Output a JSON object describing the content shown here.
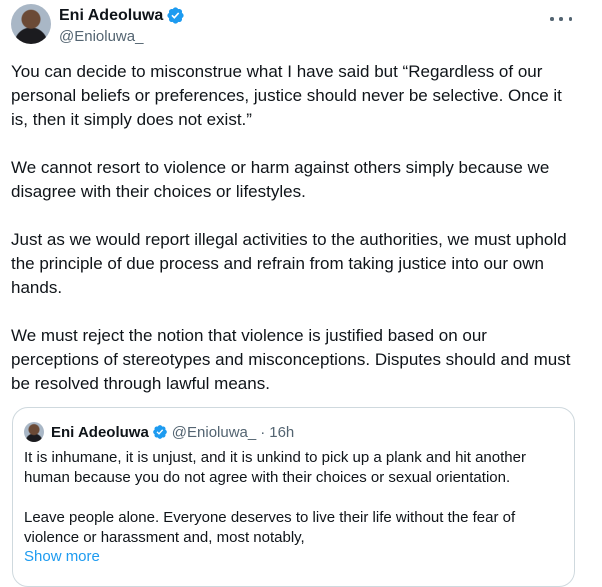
{
  "tweet": {
    "author": {
      "name": "Eni Adeoluwa",
      "handle": "@Enioluwa_"
    },
    "paragraphs": [
      "You can decide to misconstrue what I have said but “Regardless of our personal beliefs or preferences, justice should never be selective. Once it is, then it simply does not exist.”",
      "We cannot resort to violence or harm against others simply because we disagree with their choices or lifestyles.",
      "Just as we would report illegal activities to the authorities, we must uphold the principle of due process and refrain from taking justice into our own hands.",
      "We must reject the notion that violence is justified based on our perceptions of stereotypes and misconceptions. Disputes should and must be resolved through lawful means."
    ]
  },
  "quote": {
    "author": {
      "name": "Eni Adeoluwa",
      "handle": "@Enioluwa_",
      "separator": "·",
      "time": "16h"
    },
    "paragraphs": [
      "It is inhumane, it is unjust, and it is unkind to pick up a plank and hit another human because you do not agree with their choices or sexual orientation.",
      "Leave people alone. Everyone deserves to live their life without the fear of violence or harassment and, most notably,"
    ],
    "show_more": "Show more"
  },
  "icons": {
    "verified": "verified-badge-icon",
    "more": "more-horizontal-icon"
  },
  "colors": {
    "text": "#0f1419",
    "secondary": "#536471",
    "accent": "#1d9bf0",
    "border": "#cfd9de"
  }
}
